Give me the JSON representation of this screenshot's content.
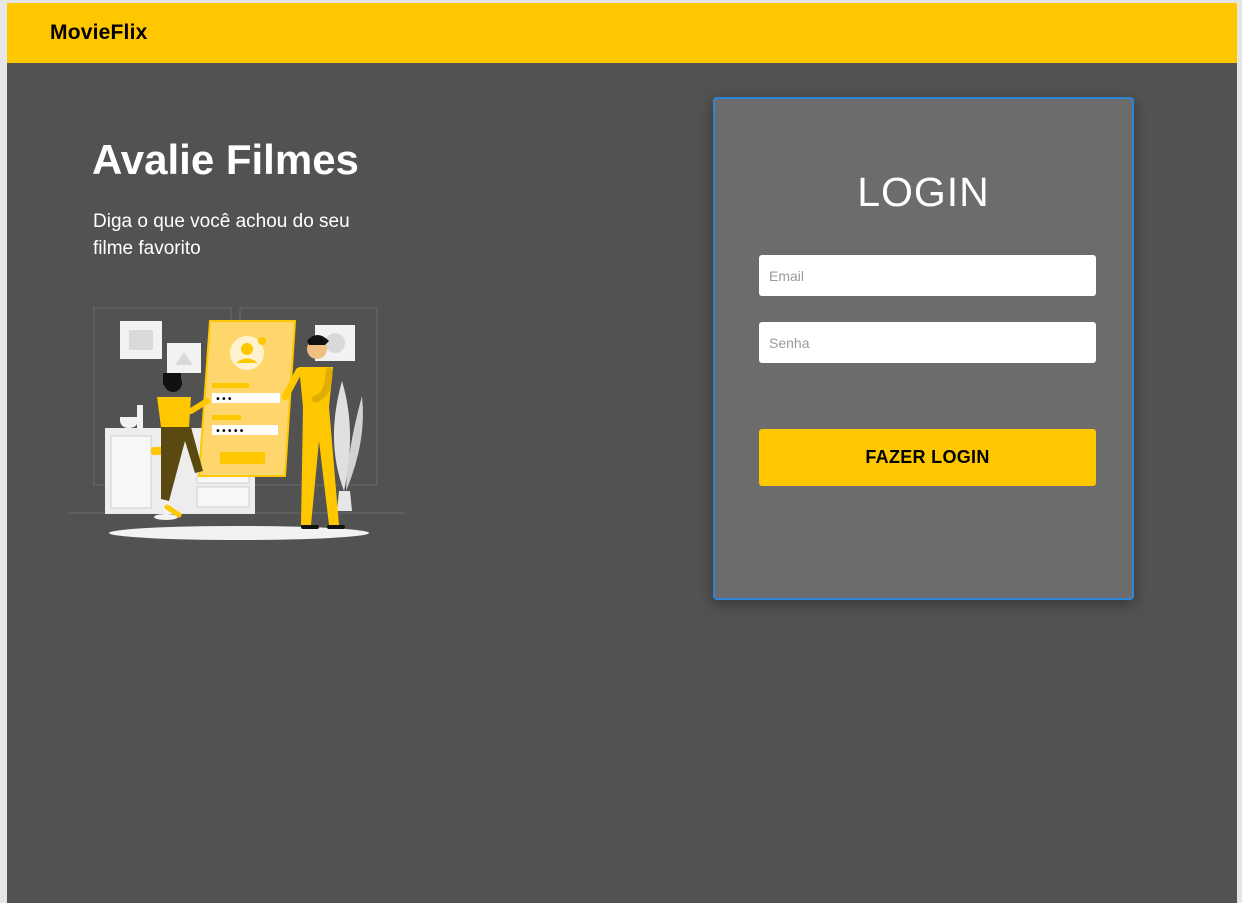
{
  "navbar": {
    "brand": "MovieFlix",
    "background": "#FFC700"
  },
  "hero": {
    "title": "Avalie Filmes",
    "subtitle": "Diga o que você achou do seu filme favorito",
    "illustration_icon": "people-login-illustration"
  },
  "login": {
    "title": "LOGIN",
    "email_placeholder": "Email",
    "email_value": "",
    "password_placeholder": "Senha",
    "password_value": "",
    "submit_label": "FAZER LOGIN",
    "card_border_color": "#2B86D9"
  },
  "colors": {
    "accent": "#FFC700",
    "page_background": "#525252",
    "card_background": "#6C6C6C"
  }
}
